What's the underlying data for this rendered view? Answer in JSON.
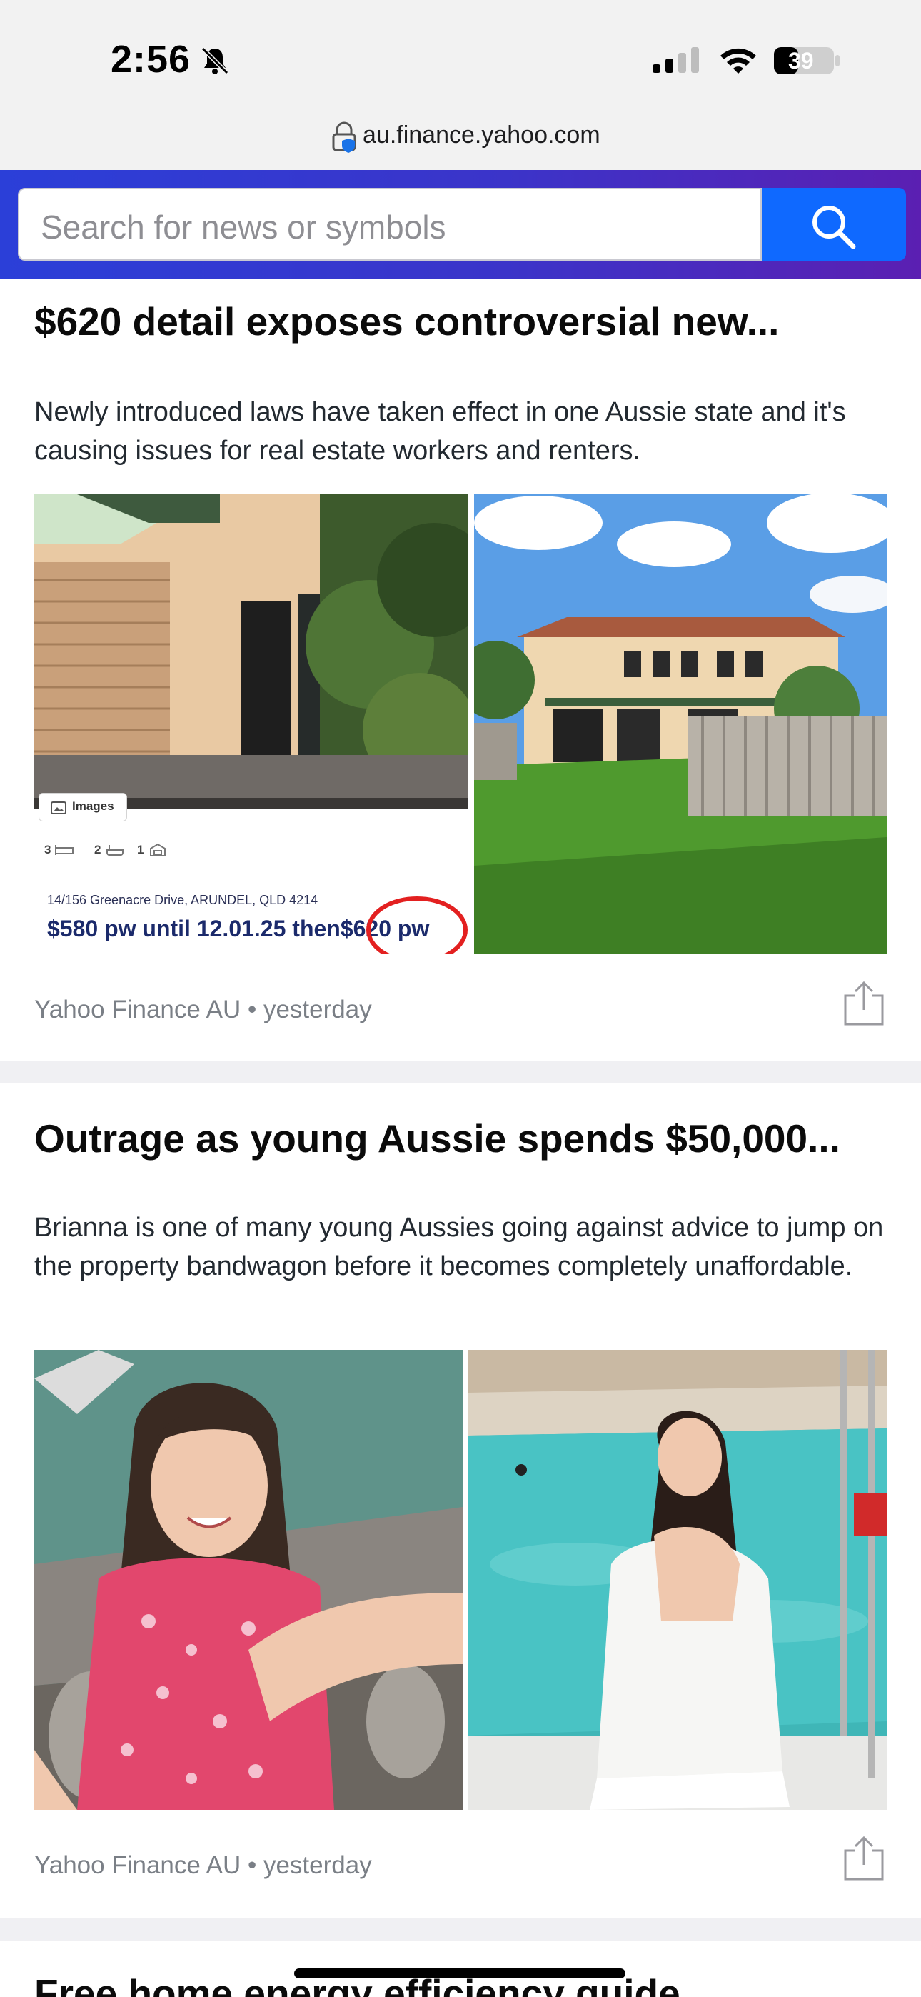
{
  "status": {
    "time": "2:56",
    "battery": "39",
    "icons": [
      "bell-slash-icon",
      "signal-icon",
      "wifi-icon",
      "battery-icon"
    ]
  },
  "browser": {
    "url": "au.finance.yahoo.com",
    "lock_icon": "lock-icon"
  },
  "search": {
    "placeholder": "Search for news or symbols",
    "button_icon": "search-icon"
  },
  "articles": [
    {
      "headline": "$620 detail exposes controversial new...",
      "summary": "Newly introduced laws have taken effect in one Aussie state and it's causing issues for real estate workers and renters.",
      "source": "Yahoo Finance AU",
      "time": "yesterday",
      "listing": {
        "images_label": "Images",
        "beds": "3",
        "baths": "2",
        "cars": "1",
        "address": "14/156 Greenacre Drive, ARUNDEL, QLD 4214",
        "price_text": "$580 pw until 12.01.25 then",
        "price_highlight": "$620 pw"
      }
    },
    {
      "headline": "Outrage as young Aussie spends $50,000...",
      "summary": "Brianna is one of many young Aussies going against advice to jump on the property bandwagon before it becomes completely unaffordable.",
      "source": "Yahoo Finance AU",
      "time": "yesterday"
    },
    {
      "headline": "Free home energy efficiency guide"
    }
  ],
  "colors": {
    "brand_blue": "#0f69ff",
    "band_start": "#2b3fd8",
    "band_end": "#5b1fb2",
    "price_navy": "#1b2a6b",
    "circle_red": "#e32020"
  }
}
